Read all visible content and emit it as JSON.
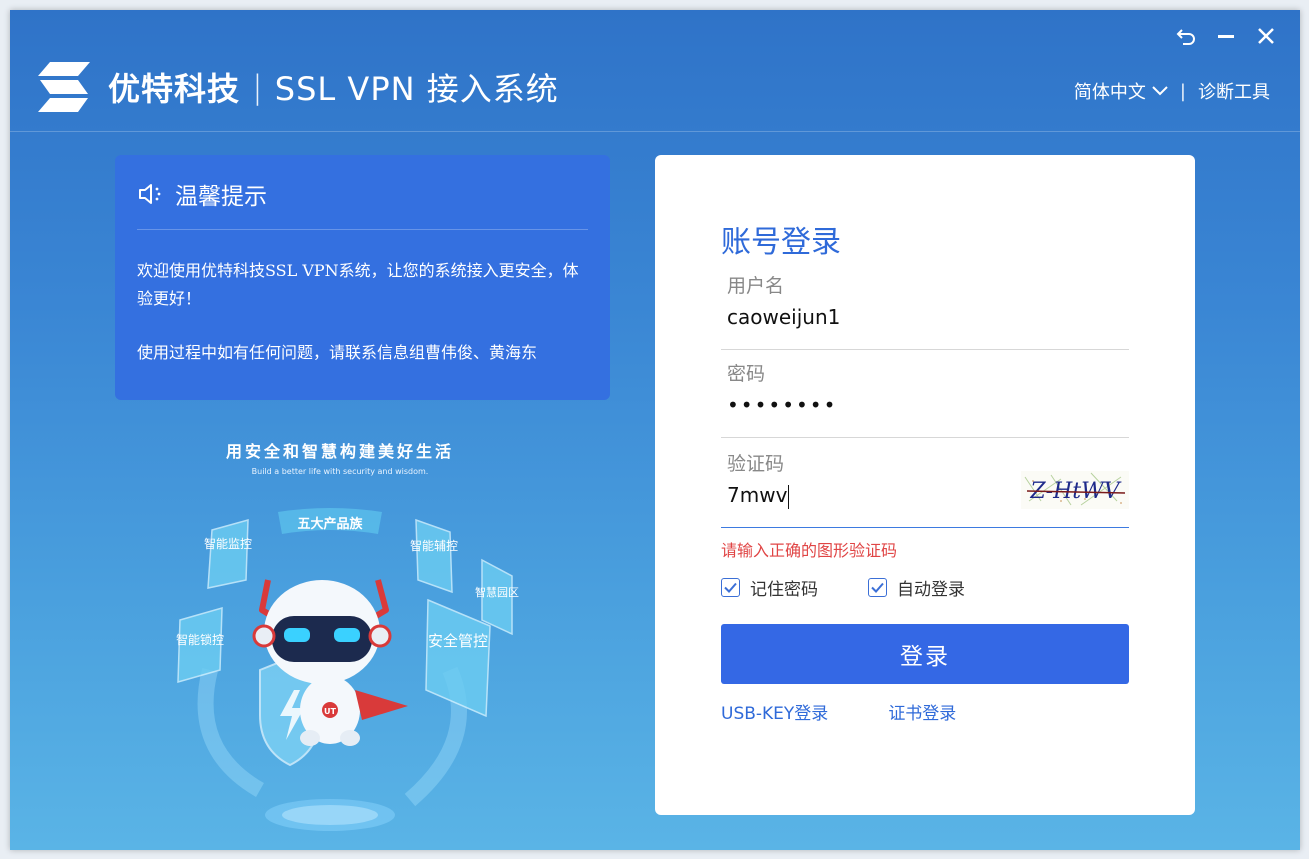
{
  "window": {
    "controls": [
      "restore-icon",
      "minimize-icon",
      "close-icon"
    ]
  },
  "header": {
    "company": "优特科技",
    "separator": "|",
    "product": "SSL VPN 接入系统",
    "language": "简体中文",
    "separator2": "|",
    "diagnostic_tool": "诊断工具"
  },
  "tips": {
    "title": "温馨提示",
    "line1": "欢迎使用优特科技SSL VPN系统，让您的系统接入更安全，体验更好！",
    "line2": "使用过程中如有任何问题，请联系信息组曹伟俊、黄海东"
  },
  "illustration": {
    "slogan": "用安全和智慧构建美好生活",
    "slogan_en": "Build a better life with security and wisdom.",
    "banner": "五大产品族",
    "cards": [
      "智能监控",
      "智能辅控",
      "智慧园区",
      "智能锁控",
      "安全管控"
    ],
    "robot_badge": "UT"
  },
  "login": {
    "title": "账号登录",
    "username_label": "用户名",
    "username_value": "caoweijun1",
    "password_label": "密码",
    "password_value": "••••••••",
    "captcha_label": "验证码",
    "captcha_value": "7mwv",
    "captcha_image_text": "Z-HtWV",
    "error_message": "请输入正确的图形验证码",
    "remember_password": "记住密码",
    "remember_checked": true,
    "auto_login": "自动登录",
    "auto_login_checked": true,
    "submit": "登录",
    "usb_key_login": "USB-KEY登录",
    "cert_login": "证书登录"
  },
  "colors": {
    "accent": "#3468e5",
    "title_blue": "#2f6ad9",
    "error": "#e04545",
    "tips_bg": "#3470e0"
  }
}
